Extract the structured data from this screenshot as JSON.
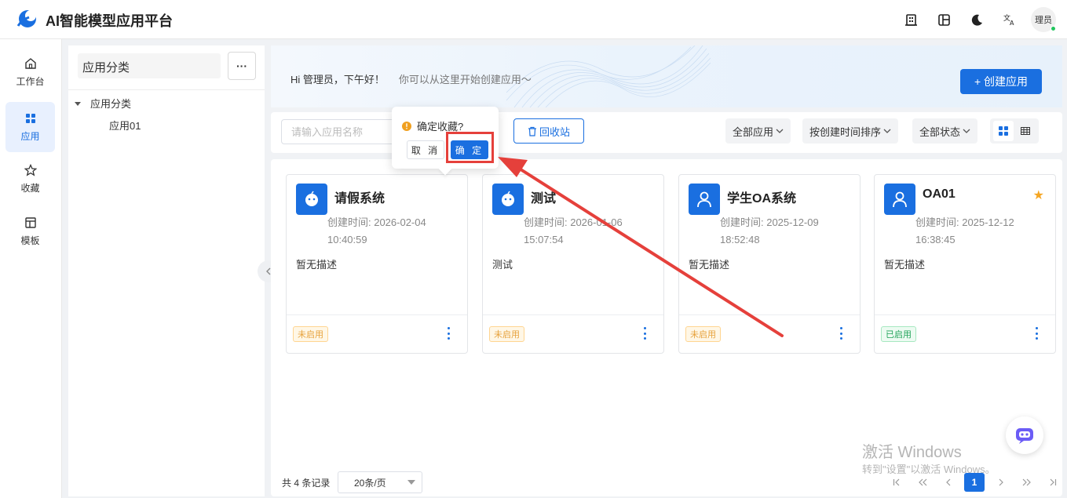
{
  "header": {
    "title": "AI智能模型应用平台",
    "icons": [
      "building-icon",
      "layout-columns-icon",
      "moon-icon",
      "translate-icon"
    ],
    "avatar_label": "理员"
  },
  "rail": {
    "items": [
      {
        "label": "工作台",
        "icon": "home-icon",
        "active": false
      },
      {
        "label": "应用",
        "icon": "apps-grid-icon",
        "active": true
      },
      {
        "label": "收藏",
        "icon": "star-icon",
        "active": false
      },
      {
        "label": "模板",
        "icon": "template-icon",
        "active": false
      }
    ]
  },
  "category_panel": {
    "header": "应用分类",
    "more_label": "···",
    "tree": {
      "root_label": "应用分类",
      "children": [
        "应用01"
      ]
    }
  },
  "banner": {
    "greeting": "Hi 管理员，下午好！",
    "subtitle": "你可以从这里开始创建应用〜",
    "create_button": "+ 创建应用"
  },
  "filters": {
    "search_placeholder": "请输入应用名称",
    "recycle_label": "回收站",
    "app_filter": "全部应用",
    "sort_filter": "按创建时间排序",
    "status_filter": "全部状态"
  },
  "popconfirm": {
    "title": "确定收藏?",
    "cancel": "取 消",
    "ok": "确 定"
  },
  "cards": [
    {
      "name": "请假系统",
      "icon": "robot-icon",
      "created_label": "创建时间: 2026-02-04",
      "created_time": "10:40:59",
      "description": "暂无描述",
      "status": "未启用",
      "status_type": "off",
      "favorite": false
    },
    {
      "name": "测试",
      "icon": "robot-icon",
      "created_label": "创建时间: 2026-01-06",
      "created_time": "15:07:54",
      "description": "测试",
      "status": "未启用",
      "status_type": "off",
      "favorite": false
    },
    {
      "name": "学生OA系统",
      "icon": "user-icon",
      "created_label": "创建时间: 2025-12-09",
      "created_time": "18:52:48",
      "description": "暂无描述",
      "status": "未启用",
      "status_type": "off",
      "favorite": false
    },
    {
      "name": "OA01",
      "icon": "user-icon",
      "created_label": "创建时间: 2025-12-12",
      "created_time": "16:38:45",
      "description": "暂无描述",
      "status": "已启用",
      "status_type": "on",
      "favorite": true
    }
  ],
  "pagination": {
    "total": "共 4 条记录",
    "page_size": "20条/页",
    "current_page": "1"
  },
  "watermark": {
    "line1": "激活 Windows",
    "line2": "转到\"设置\"以激活 Windows。"
  },
  "colors": {
    "primary": "#1a6fe0",
    "annotation": "#e5403b",
    "favorite": "#f5a623"
  }
}
